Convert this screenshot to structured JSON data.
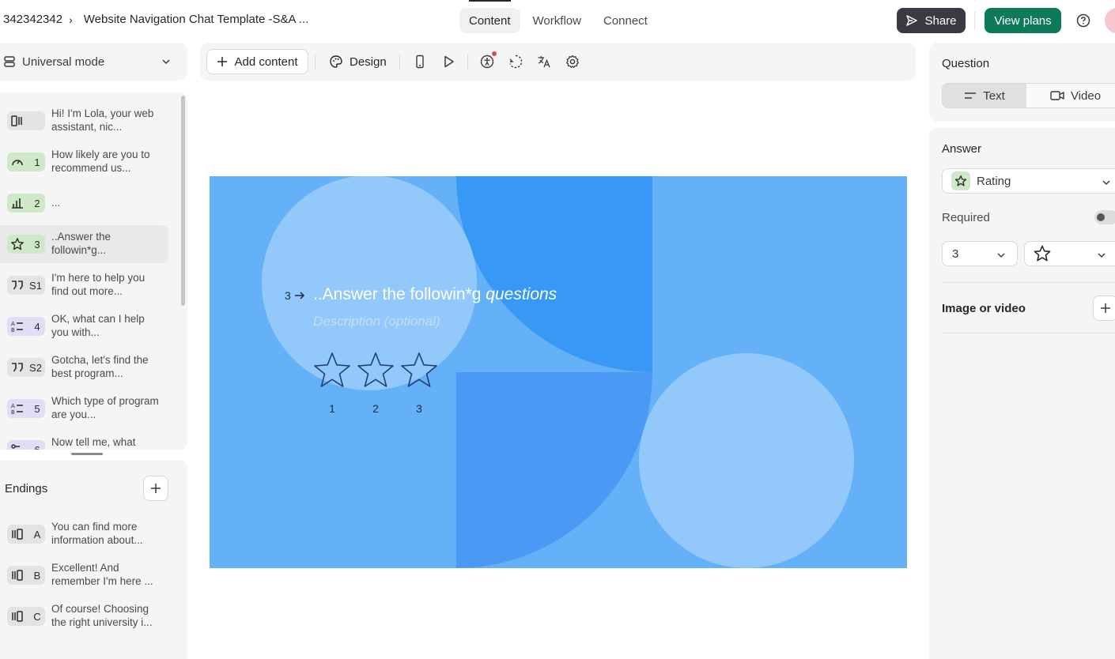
{
  "header": {
    "workspace": "342342342",
    "form_title": "Website Navigation Chat Template -S&A ...",
    "tabs": [
      {
        "label": "Content",
        "active": true
      },
      {
        "label": "Workflow",
        "active": false
      },
      {
        "label": "Connect",
        "active": false
      }
    ],
    "share_label": "Share",
    "view_plans_label": "View plans"
  },
  "sidebar": {
    "mode_label": "Universal mode",
    "questions": [
      {
        "badge": "",
        "icon": "welcome-screen-icon",
        "color": "gray",
        "text": "Hi! I'm Lola, your web assistant, nic..."
      },
      {
        "badge": "1",
        "icon": "opinion-scale-icon",
        "color": "green",
        "text": "How likely are you to recommend us..."
      },
      {
        "badge": "2",
        "icon": "bar-chart-icon",
        "color": "green",
        "text": "..."
      },
      {
        "badge": "3",
        "icon": "star-icon",
        "color": "green",
        "text": "..Answer the followin*g...",
        "selected": true
      },
      {
        "badge": "S1",
        "icon": "quote-icon",
        "color": "gray",
        "text": "I'm here to help you find out more..."
      },
      {
        "badge": "4",
        "icon": "multiple-choice-icon",
        "color": "purple",
        "text": "OK, what can I help you with..."
      },
      {
        "badge": "S2",
        "icon": "quote-icon",
        "color": "gray",
        "text": "Gotcha, let's find the best program..."
      },
      {
        "badge": "5",
        "icon": "multiple-choice-icon",
        "color": "purple",
        "text": "Which type of program are you..."
      },
      {
        "badge": "6",
        "icon": "branch-icon",
        "color": "purple",
        "text": "Now tell me, what"
      }
    ],
    "endings_title": "Endings",
    "endings": [
      {
        "badge": "A",
        "icon": "ending-screen-icon",
        "text": "You can find more information about..."
      },
      {
        "badge": "B",
        "icon": "ending-screen-icon",
        "text": "Excellent! And remember I'm here ..."
      },
      {
        "badge": "C",
        "icon": "ending-screen-icon",
        "text": "Of course! Choosing the right university i..."
      }
    ]
  },
  "toolbar": {
    "add_content_label": "Add content",
    "design_label": "Design",
    "icons": [
      "mobile-preview-icon",
      "play-icon",
      "accessibility-icon",
      "loading-icon",
      "translate-icon",
      "settings-icon"
    ]
  },
  "canvas": {
    "background": "#65b1f8",
    "question_number": "3",
    "question_title_plain": "..Answer the followin*g ",
    "question_title_italic": "questions",
    "description_placeholder": "Description (optional)",
    "star_labels": [
      "1",
      "2",
      "3"
    ]
  },
  "right_panel": {
    "question_title": "Question",
    "type_options": [
      "Text",
      "Video"
    ],
    "answer_title": "Answer",
    "answer_type": "Rating",
    "required_label": "Required",
    "steps_value": "3",
    "shape_icon": "star-icon",
    "image_or_video_label": "Image or video"
  },
  "colors": {
    "accent_green": "#0f7a5a",
    "share_dark": "#3b3a42",
    "rating_badge": "#cfe9c8",
    "choice_badge": "#e3dcf7"
  }
}
